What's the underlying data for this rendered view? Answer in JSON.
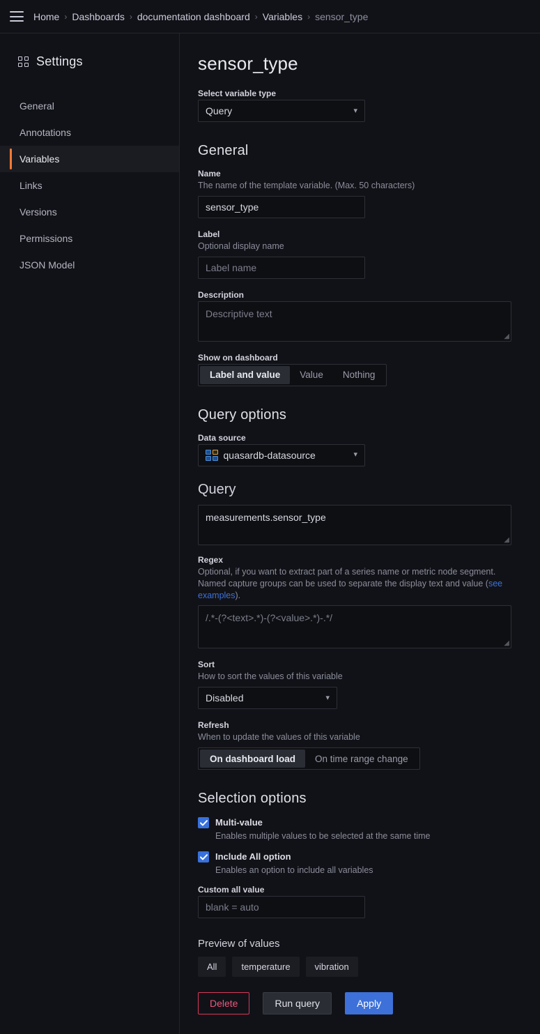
{
  "topbar": {
    "menu_icon": "hamburger-icon",
    "breadcrumb": [
      {
        "label": "Home",
        "current": false
      },
      {
        "label": "Dashboards",
        "current": false
      },
      {
        "label": "documentation dashboard",
        "current": false
      },
      {
        "label": "Variables",
        "current": false
      },
      {
        "label": "sensor_type",
        "current": true
      }
    ],
    "separator": "›"
  },
  "sidebar": {
    "icon": "apps-grid-icon",
    "title": "Settings",
    "items": [
      {
        "label": "General",
        "active": false
      },
      {
        "label": "Annotations",
        "active": false
      },
      {
        "label": "Variables",
        "active": true
      },
      {
        "label": "Links",
        "active": false
      },
      {
        "label": "Versions",
        "active": false
      },
      {
        "label": "Permissions",
        "active": false
      },
      {
        "label": "JSON Model",
        "active": false
      }
    ],
    "active_accent_color": "#ff7a33"
  },
  "main": {
    "page_title": "sensor_type",
    "variable_type": {
      "label": "Select variable type",
      "value": "Query",
      "chevron": "chevron-down-icon"
    },
    "general": {
      "heading": "General",
      "name": {
        "label": "Name",
        "description": "The name of the template variable. (Max. 50 characters)",
        "value": "sensor_type"
      },
      "label_field": {
        "label": "Label",
        "description": "Optional display name",
        "placeholder": "Label name",
        "value": ""
      },
      "description_field": {
        "label": "Description",
        "placeholder": "Descriptive text",
        "value": ""
      },
      "show_on_dashboard": {
        "label": "Show on dashboard",
        "options": [
          "Label and value",
          "Value",
          "Nothing"
        ],
        "selected": "Label and value"
      }
    },
    "query_options": {
      "heading": "Query options",
      "data_source": {
        "label": "Data source",
        "value": "quasardb-datasource",
        "icon": "quasardb-datasource-icon",
        "chevron": "chevron-down-icon"
      },
      "query": {
        "heading": "Query",
        "value": "measurements.sensor_type"
      },
      "regex": {
        "label": "Regex",
        "description_part1": "Optional, if you want to extract part of a series name or metric node segment. Named capture groups can be used to separate the display text and value (",
        "link_text": "see examples",
        "description_part2": ").",
        "placeholder": "/.*-(?<text>.*)-(?<value>.*)-.*/",
        "value": ""
      },
      "sort": {
        "label": "Sort",
        "description": "How to sort the values of this variable",
        "value": "Disabled",
        "chevron": "chevron-down-icon"
      },
      "refresh": {
        "label": "Refresh",
        "description": "When to update the values of this variable",
        "options": [
          "On dashboard load",
          "On time range change"
        ],
        "selected": "On dashboard load"
      }
    },
    "selection_options": {
      "heading": "Selection options",
      "multi_value": {
        "label": "Multi-value",
        "description": "Enables multiple values to be selected at the same time",
        "checked": true
      },
      "include_all": {
        "label": "Include All option",
        "description": "Enables an option to include all variables",
        "checked": true
      },
      "custom_all_value": {
        "label": "Custom all value",
        "placeholder": "blank = auto",
        "value": ""
      }
    },
    "preview": {
      "heading": "Preview of values",
      "values": [
        "All",
        "temperature",
        "vibration"
      ]
    },
    "actions": {
      "delete": "Delete",
      "run_query": "Run query",
      "apply": "Apply",
      "delete_color": "#f0567d",
      "apply_color": "#3d71d9"
    }
  }
}
